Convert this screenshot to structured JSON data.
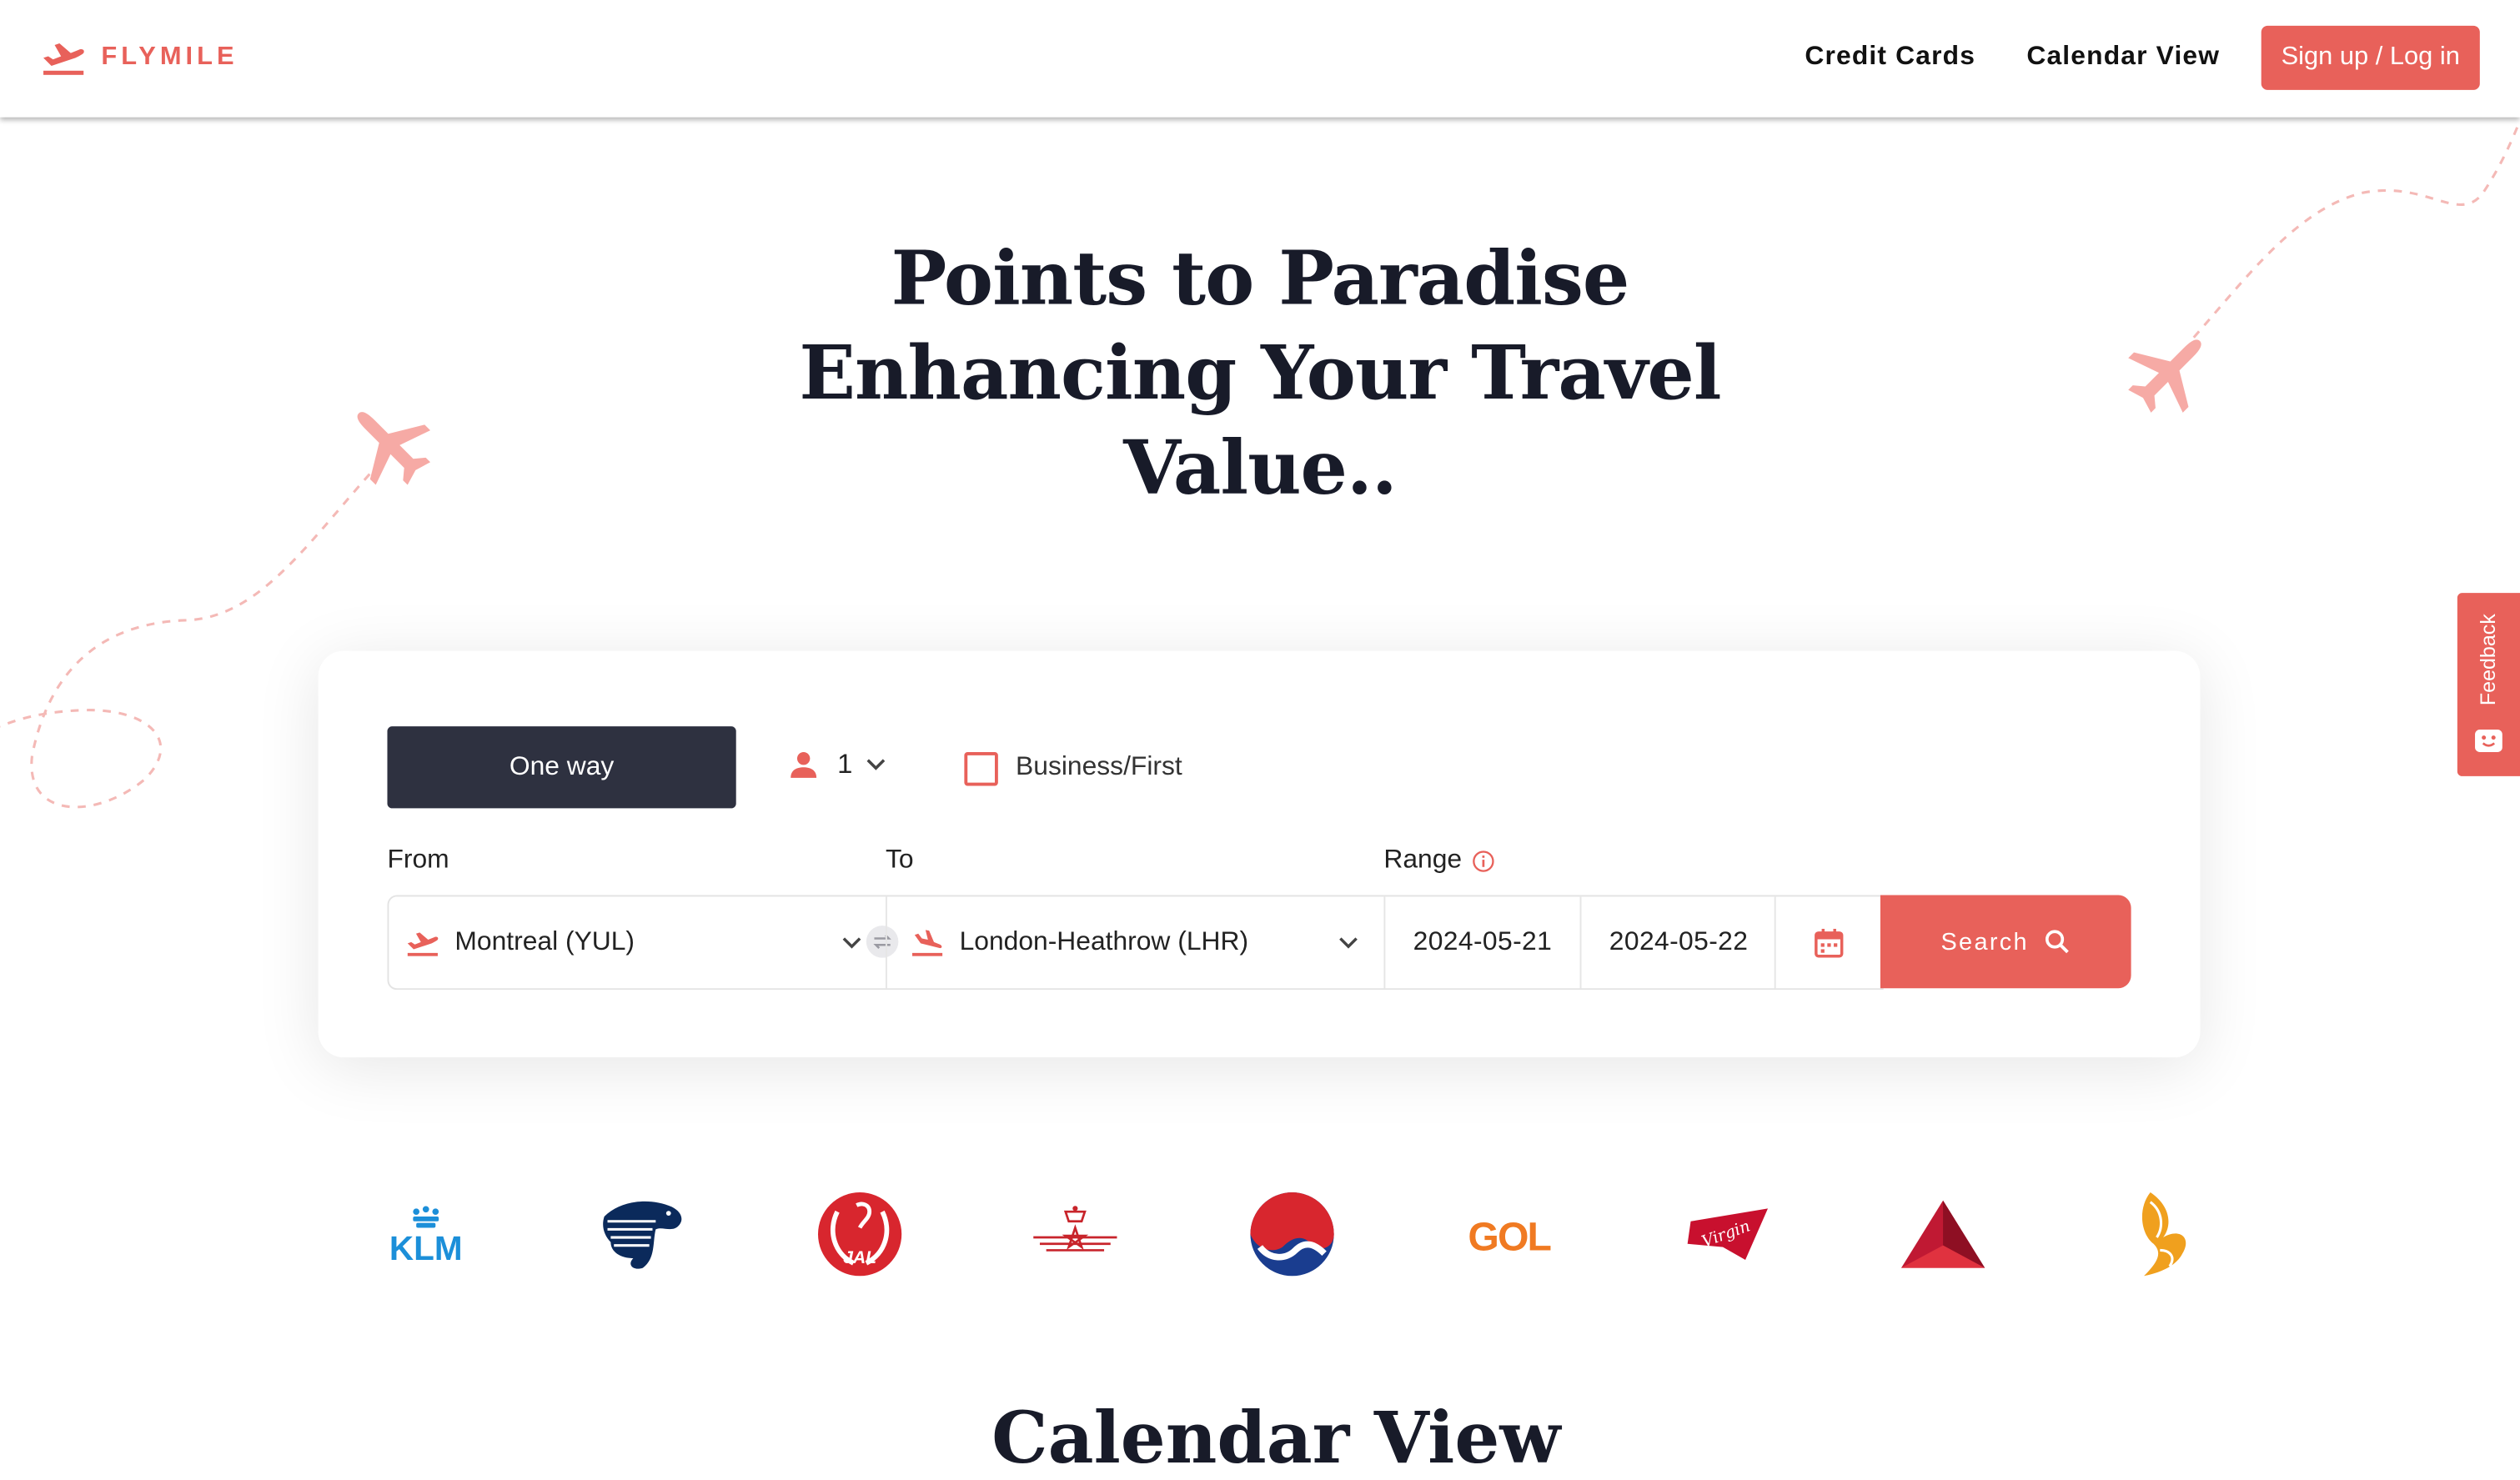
{
  "brand": {
    "name": "FLYMILE",
    "accent_color": "#e8615a",
    "dark_color": "#2e3140"
  },
  "nav": {
    "links": [
      "Credit Cards",
      "Calendar View"
    ],
    "signup_label": "Sign up / Log in"
  },
  "hero": {
    "lines": [
      "Points to Paradise",
      "Enhancing Your Travel",
      "Value.."
    ]
  },
  "search": {
    "trip_type": "One way",
    "passengers": "1",
    "cabin_label": "Business/First",
    "cabin_checked": false,
    "from_label": "From",
    "to_label": "To",
    "range_label": "Range",
    "from_value": "Montreal (YUL)",
    "to_value": "London-Heathrow (LHR)",
    "date_start": "2024-05-21",
    "date_end": "2024-05-22",
    "search_label": "Search"
  },
  "feedback": {
    "label": "Feedback"
  },
  "airlines": [
    {
      "name": "KLM",
      "logo_text": "KLM",
      "icon": "klm-logo",
      "color": "#1c8fd9"
    },
    {
      "name": "Aeromexico",
      "icon": "aeromexico-logo",
      "color": "#0b2a5b"
    },
    {
      "name": "JAL",
      "logo_text": "JAL",
      "icon": "jal-logo",
      "color": "#d8262e"
    },
    {
      "name": "Royal Air Maroc",
      "icon": "royal-air-maroc-logo",
      "color": "#c8242b"
    },
    {
      "name": "Korean Air",
      "icon": "korean-air-logo",
      "color": "#1a3d8f"
    },
    {
      "name": "GOL",
      "logo_text": "GOL",
      "icon": "gol-logo",
      "color": "#f07a22"
    },
    {
      "name": "Virgin",
      "logo_text": "Virgin",
      "icon": "virgin-logo",
      "color": "#c8102e"
    },
    {
      "name": "Delta",
      "icon": "delta-logo",
      "color": "#c01933"
    },
    {
      "name": "Singapore Airlines",
      "icon": "singapore-airlines-logo",
      "color": "#f0a01e"
    }
  ],
  "next_section": {
    "heading_partial": "Calendar View"
  }
}
